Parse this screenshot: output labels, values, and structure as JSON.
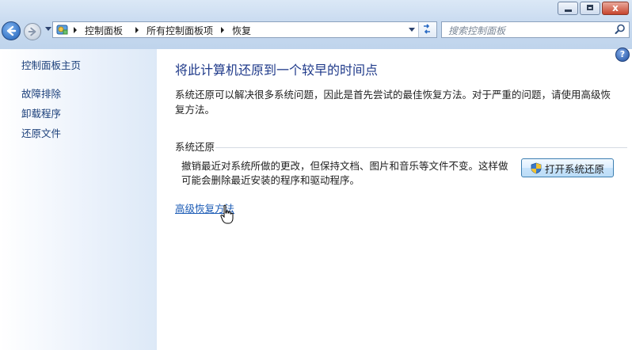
{
  "window": {
    "minimize_symbol": "",
    "maximize_symbol": "",
    "close_symbol": "x"
  },
  "address_bar": {
    "breadcrumbs": [
      "控制面板",
      "所有控制面板项",
      "恢复"
    ]
  },
  "search": {
    "placeholder": "搜索控制面板"
  },
  "sidebar": {
    "items": [
      {
        "label": "控制面板主页"
      },
      {
        "label": "故障排除"
      },
      {
        "label": "卸载程序"
      },
      {
        "label": "还原文件"
      }
    ]
  },
  "main": {
    "help": "?",
    "title": "将此计算机还原到一个较早的时间点",
    "description": "系统还原可以解决很多系统问题，因此是首先尝试的最佳恢复方法。对于严重的问题，请使用高级恢复方法。",
    "system_restore": {
      "group_label": "系统还原",
      "description": "撤销最近对系统所做的更改，但保持文档、图片和音乐等文件不变。这样做可能会删除最近安装的程序和驱动程序。",
      "button_label": "打开系统还原",
      "button_icon": "uac-shield-icon"
    },
    "advanced_link": "高级恢复方法"
  }
}
